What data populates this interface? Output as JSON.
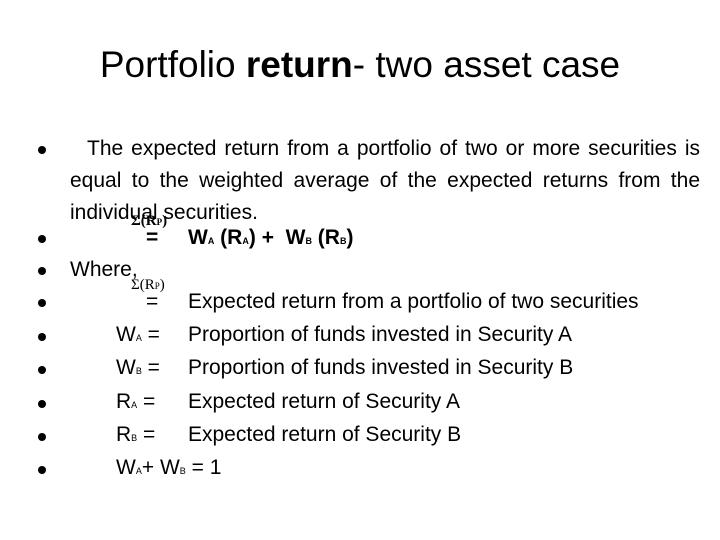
{
  "title": {
    "part1": "Portfolio ",
    "bold": "return",
    "part2": "- two asset case"
  },
  "intro": "The expected return from a portfolio of two or more securities is equal to the weighted average of the expected returns from the individual securities.",
  "formula": {
    "lhs": "Σ(R",
    "lhs_sub": "P",
    "lhs_close": ")",
    "equals": "=",
    "w_a": "W",
    "w_a_sub": "A",
    "r_a_open": "(R",
    "r_a_sub": "A",
    "r_a_close": ")",
    "plus": "+",
    "w_b": "W",
    "w_b_sub": "B",
    "r_b_open": "(R",
    "r_b_sub": "B",
    "r_b_close": ")"
  },
  "where_label": "Where,",
  "definitions": [
    {
      "term": "Σ(R",
      "sub": "P",
      "close": ")",
      "eq": "=",
      "text": "Expected return from a portfolio of two securities"
    },
    {
      "term": "W",
      "sub": "A",
      "eq": " =",
      "text": "Proportion of funds invested in Security A"
    },
    {
      "term": "W",
      "sub": "B",
      "eq": " =",
      "text": "Proportion of funds invested in Security B"
    },
    {
      "term": "R",
      "sub": "A",
      "eq": " =",
      "text": "Expected return of Security A"
    },
    {
      "term": "R",
      "sub": "B",
      "eq": " =",
      "text": "Expected return of Security B"
    }
  ],
  "constraint": {
    "w_a": "W",
    "w_a_sub": "A",
    "plus": "+ ",
    "w_b": "W",
    "w_b_sub": "B",
    "rest": " = 1"
  }
}
